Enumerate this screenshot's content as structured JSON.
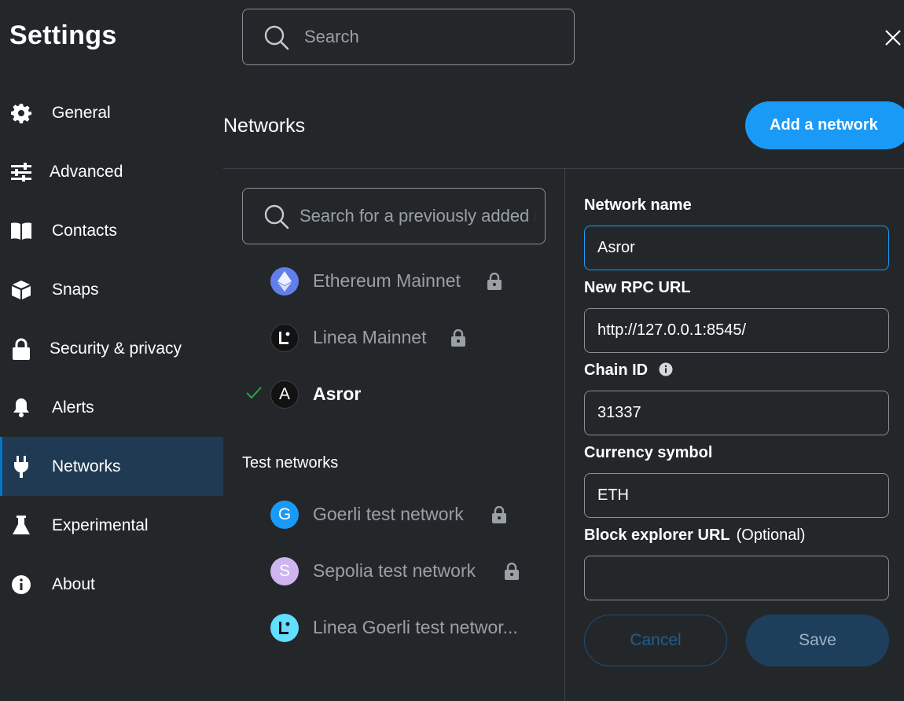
{
  "settings_title": "Settings",
  "search": {
    "placeholder": "Search"
  },
  "sidebar": {
    "items": [
      {
        "label": "General",
        "icon": "gear-icon"
      },
      {
        "label": "Advanced",
        "icon": "sliders-icon"
      },
      {
        "label": "Contacts",
        "icon": "book-icon"
      },
      {
        "label": "Snaps",
        "icon": "box-icon"
      },
      {
        "label": "Security & privacy",
        "icon": "lock-icon"
      },
      {
        "label": "Alerts",
        "icon": "bell-icon"
      },
      {
        "label": "Networks",
        "icon": "plug-icon",
        "active": true
      },
      {
        "label": "Experimental",
        "icon": "flask-icon"
      },
      {
        "label": "About",
        "icon": "info-icon"
      }
    ]
  },
  "main": {
    "title": "Networks",
    "add_network_label": "Add a network",
    "network_search": {
      "placeholder": "Search for a previously added network"
    },
    "networks": [
      {
        "name": "Ethereum Mainnet",
        "locked": true,
        "avatar": "ethereum-icon"
      },
      {
        "name": "Linea Mainnet",
        "locked": true,
        "avatar": "linea-icon"
      },
      {
        "name": "Asror",
        "selected": true,
        "avatar_letter": "A"
      }
    ],
    "test_networks_title": "Test networks",
    "test_networks": [
      {
        "name": "Goerli test network",
        "locked": true,
        "avatar_letter": "G",
        "color": "#1a9af7"
      },
      {
        "name": "Sepolia test network",
        "locked": true,
        "avatar_letter": "S",
        "color": "#cfb5f0"
      },
      {
        "name": "Linea Goerli test networ...",
        "avatar": "linea-icon",
        "color": "#61dfff"
      }
    ]
  },
  "form": {
    "network_name_label": "Network name",
    "network_name_value": "Asror",
    "rpc_url_label": "New RPC URL",
    "rpc_url_value": "http://127.0.0.1:8545/",
    "chain_id_label": "Chain ID",
    "chain_id_value": "31337",
    "currency_symbol_label": "Currency symbol",
    "currency_symbol_value": "ETH",
    "block_explorer_label": "Block explorer URL",
    "block_explorer_optional": "(Optional)",
    "block_explorer_value": "",
    "cancel_label": "Cancel",
    "save_label": "Save"
  },
  "colors": {
    "accent": "#1a9af7",
    "background": "#24272a",
    "active_nav": "#1f3a52"
  }
}
